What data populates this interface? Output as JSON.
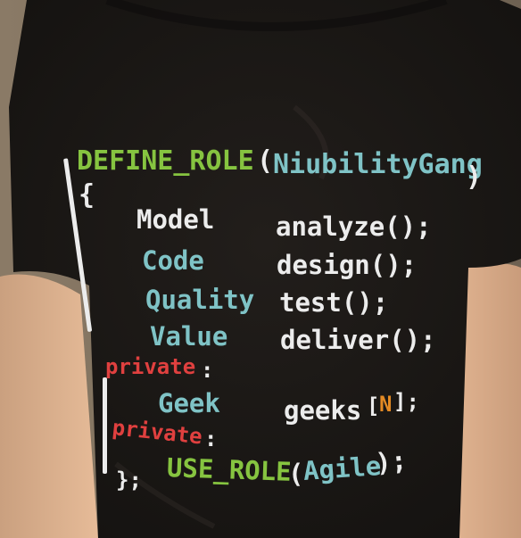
{
  "colors": {
    "keyword": "#86c440",
    "identifier": "#7fc3c6",
    "plain": "#ececec",
    "private": "#e0403f",
    "constant": "#e38a24",
    "shirt": "#1a1714",
    "skin": "#d9ab88"
  },
  "shirt_print": {
    "define_role": "DEFINE_ROLE",
    "open_paren": "(",
    "gang_name": "NiubilityGang",
    "close_paren": ")",
    "open_brace": "{",
    "role_rows": [
      {
        "role": "Model",
        "method": "analyze();"
      },
      {
        "role": "Code",
        "method": "design();"
      },
      {
        "role": "Quality",
        "method": "test();"
      },
      {
        "role": "Value",
        "method": "deliver();"
      }
    ],
    "private_1": "private",
    "colon_1": ":",
    "member_type": "Geek",
    "member_name": "geeks",
    "bracket_open": "[",
    "array_size": "N",
    "bracket_close": "];",
    "private_2": "private",
    "colon_2": ":",
    "use_role": "USE_ROLE",
    "use_open_paren": "(",
    "use_arg": "Agile",
    "use_close": ");",
    "close_brace": "};"
  }
}
